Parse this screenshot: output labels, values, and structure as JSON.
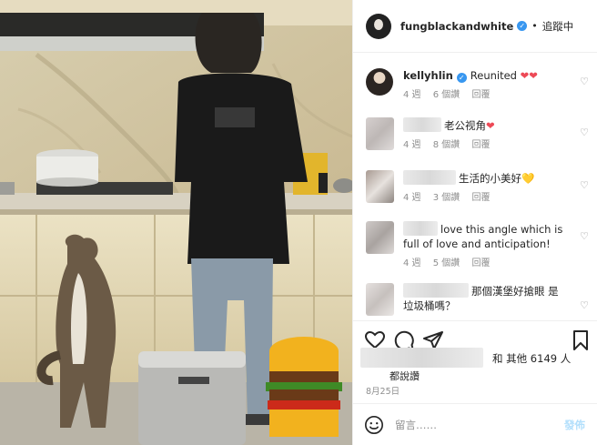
{
  "post": {
    "username": "fungblackandwhite",
    "follow_status": "追蹤中",
    "photo_alt_icon": "photo"
  },
  "comments": [
    {
      "username": "kellyhlin",
      "text": "Reunited",
      "emoji": "❤❤",
      "time": "4 週",
      "likes": "6 個讚",
      "reply": "回覆"
    },
    {
      "username": "",
      "text": "老公视角",
      "emoji": "❤",
      "time": "4 週",
      "likes": "8 個讚",
      "reply": "回覆"
    },
    {
      "username": "",
      "text": "生活的小美好",
      "emoji": "💛",
      "time": "4 週",
      "likes": "3 個讚",
      "reply": "回覆"
    },
    {
      "username": "",
      "text": "love this angle which is full of love and anticipation!",
      "time": "4 週",
      "likes": "5 個讚",
      "reply": "回覆"
    },
    {
      "username": "",
      "text": "那個漢堡好搶眼 是垃圾桶嗎？"
    }
  ],
  "likes": {
    "text": "和 其他 6149 人",
    "line2": "都說讚"
  },
  "date": "8月25日",
  "add_comment": {
    "placeholder": "留言……",
    "post_label": "發佈"
  },
  "colors": {
    "verified": "#3897f0",
    "heart": "#ed4956",
    "post_button": "#b2dffc"
  }
}
